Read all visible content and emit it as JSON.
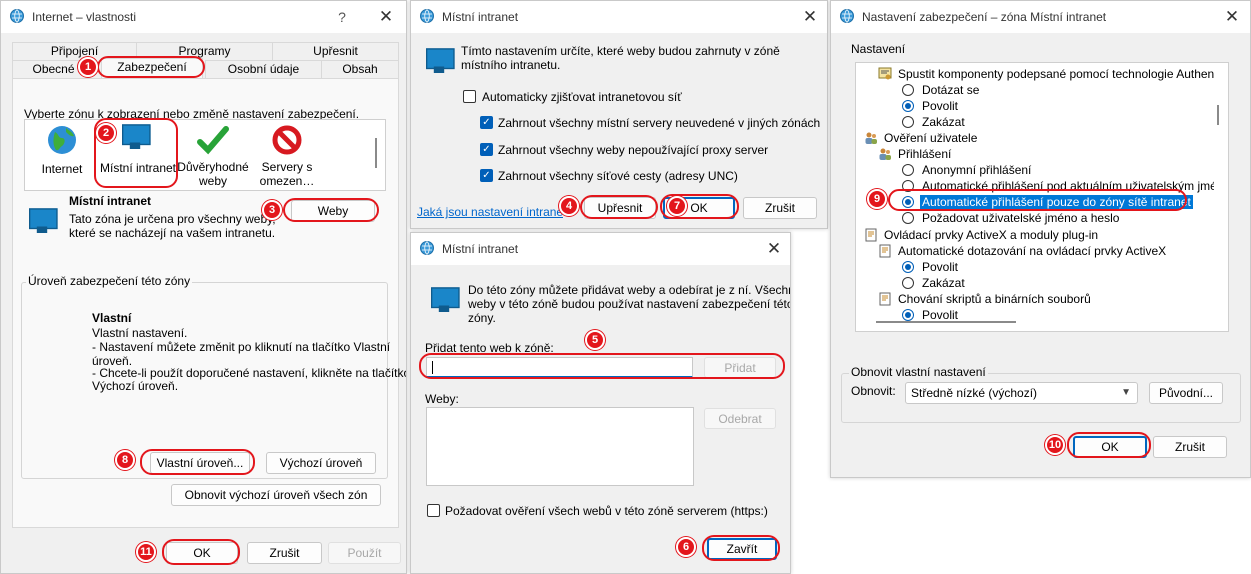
{
  "d1": {
    "title": "Internet – vlastnosti",
    "help": "?",
    "close": "✕",
    "tabs_row1": [
      "Připojení",
      "Programy",
      "Upřesnit"
    ],
    "tabs_row2": [
      "Obecné",
      "Zabezpečení",
      "Osobní údaje",
      "Obsah"
    ],
    "zone_prompt": "Vyberte zónu k zobrazení nebo změně nastavení zabezpečení.",
    "zones": [
      {
        "l1": "Internet",
        "l2": "",
        "icon": "globe-icon"
      },
      {
        "l1": "Místní intranet",
        "l2": "",
        "icon": "monitor-icon"
      },
      {
        "l1": "Důvěryhodné",
        "l2": "weby",
        "icon": "checkmark-icon"
      },
      {
        "l1": "Servery s",
        "l2": "omezen…",
        "icon": "prohibited-icon"
      }
    ],
    "zone_title": "Místní intranet",
    "zone_desc1": "Tato zóna je určena pro všechny weby,",
    "zone_desc2": "které se nacházejí na vašem intranetu.",
    "sites_btn": "Weby",
    "level_group": "Úroveň zabezpečení této zóny",
    "level_title": "Vlastní",
    "level_lines": [
      "Vlastní nastavení.",
      "- Nastavení můžete změnit po kliknutí na tlačítko Vlastní",
      "úroveň.",
      "- Chcete-li použít doporučené nastavení, klikněte na tlačítko",
      "Výchozí úroveň."
    ],
    "custom_btn": "Vlastní úroveň...",
    "default_btn": "Výchozí úroveň",
    "reset_all_btn": "Obnovit výchozí úroveň všech zón",
    "ok": "OK",
    "cancel": "Zrušit",
    "apply": "Použít"
  },
  "d2": {
    "title": "Místní intranet",
    "close": "✕",
    "intro1": "Tímto nastavením určíte, které weby budou zahrnuty v zóně",
    "intro2": "místního intranetu.",
    "auto_detect": "Automaticky zjišťovat intranetovou síť",
    "cb1": "Zahrnout všechny místní servery neuvedené v jiných zónách",
    "cb2": "Zahrnout všechny weby nepoužívající proxy server",
    "cb3": "Zahrnout všechny síťové cesty (adresy UNC)",
    "link": "Jaká jsou nastavení intranetu?",
    "advanced_btn": "Upřesnit",
    "ok": "OK",
    "cancel": "Zrušit"
  },
  "d3": {
    "title": "Místní intranet",
    "close": "✕",
    "intro1": "Do této zóny můžete přidávat weby a odebírat je z ní. Všechny",
    "intro2": "weby v této zóně budou používat nastavení zabezpečení této",
    "intro3": "zóny.",
    "add_label": "Přidat tento web k zóně:",
    "add_value": "",
    "add_btn": "Přidat",
    "sites_label": "Weby:",
    "remove_btn": "Odebrat",
    "https_label": "Požadovat ověření všech webů v této zóně serverem (https:)",
    "close_btn": "Zavřít"
  },
  "d4": {
    "title": "Nastavení zabezpečení – zóna Místní intranet",
    "close": "✕",
    "settings_label": "Nastavení",
    "tree": [
      {
        "text": "Spustit komponenty podepsané pomocí technologie Authenticode",
        "kind": "folder",
        "indent": 1
      },
      {
        "text": "Dotázat se",
        "kind": "radio",
        "checked": false,
        "indent": 2
      },
      {
        "text": "Povolit",
        "kind": "radio",
        "checked": true,
        "indent": 2
      },
      {
        "text": "Zakázat",
        "kind": "radio",
        "checked": false,
        "indent": 2
      },
      {
        "text": "Ověření uživatele",
        "kind": "users",
        "indent": 0
      },
      {
        "text": "Přihlášení",
        "kind": "users",
        "indent": 1
      },
      {
        "text": "Anonymní přihlášení",
        "kind": "radio",
        "checked": false,
        "indent": 2
      },
      {
        "text": "Automatické přihlášení pod aktuálním uživatelským jménem a",
        "kind": "radio",
        "checked": false,
        "indent": 2
      },
      {
        "text": "Automatické přihlášení pouze do zóny sítě intranet",
        "kind": "radio",
        "checked": true,
        "indent": 2,
        "selected": true
      },
      {
        "text": "Požadovat uživatelské jméno a heslo",
        "kind": "radio",
        "checked": false,
        "indent": 2
      },
      {
        "text": "Ovládací prvky ActiveX a moduly plug-in",
        "kind": "doc",
        "indent": 0
      },
      {
        "text": "Automatické dotazování na ovládací prvky ActiveX",
        "kind": "doc",
        "indent": 1
      },
      {
        "text": "Povolit",
        "kind": "radio",
        "checked": true,
        "indent": 2
      },
      {
        "text": "Zakázat",
        "kind": "radio",
        "checked": false,
        "indent": 2
      },
      {
        "text": "Chování skriptů a binárních souborů",
        "kind": "doc",
        "indent": 1
      },
      {
        "text": "Povolit",
        "kind": "radio",
        "checked": true,
        "indent": 2
      }
    ],
    "reset_group": "Obnovit vlastní nastavení",
    "reset_label": "Obnovit:",
    "reset_value": "Středně nízké (výchozí)",
    "reset_btn": "Původní...",
    "ok": "OK",
    "cancel": "Zrušit"
  },
  "badges": [
    "1",
    "2",
    "3",
    "4",
    "5",
    "6",
    "7",
    "8",
    "9",
    "10",
    "11"
  ],
  "colors": {
    "accent": "#0067c0",
    "annotation": "#e3161c",
    "selection": "#0078d7",
    "link": "#0066cc"
  }
}
